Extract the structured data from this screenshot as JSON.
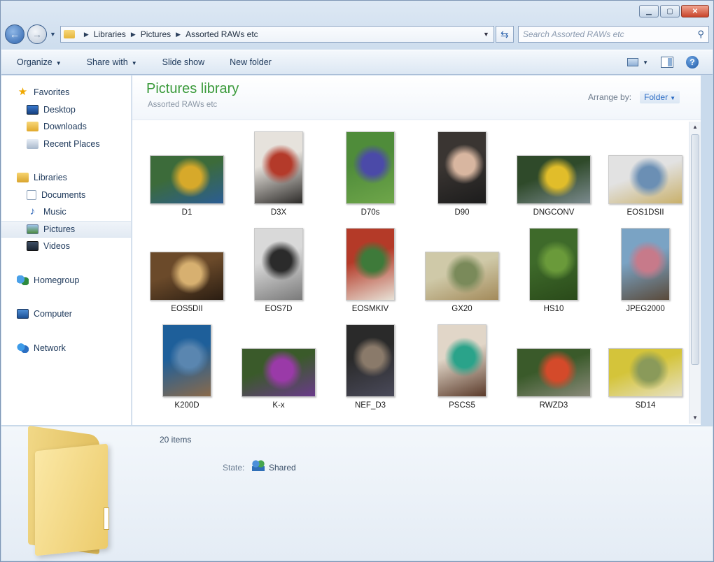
{
  "window": {
    "caption_buttons": [
      "minimize",
      "maximize",
      "close"
    ]
  },
  "address": {
    "crumbs": [
      "Libraries",
      "Pictures",
      "Assorted RAWs etc"
    ],
    "search_placeholder": "Search Assorted RAWs etc"
  },
  "toolbar": {
    "organize": "Organize",
    "share_with": "Share with",
    "slide_show": "Slide show",
    "new_folder": "New folder"
  },
  "nav": {
    "favorites": "Favorites",
    "desktop": "Desktop",
    "downloads": "Downloads",
    "recent_places": "Recent Places",
    "libraries": "Libraries",
    "documents": "Documents",
    "music": "Music",
    "pictures": "Pictures",
    "videos": "Videos",
    "homegroup": "Homegroup",
    "computer": "Computer",
    "network": "Network"
  },
  "library": {
    "title": "Pictures library",
    "subtitle": "Assorted RAWs etc",
    "arrange_label": "Arrange by:",
    "arrange_value": "Folder"
  },
  "items": [
    {
      "label": "D1",
      "orient": "land",
      "colors": [
        "#3c6b3a",
        "#d7a92a",
        "#2b5d94"
      ]
    },
    {
      "label": "D3X",
      "orient": "port",
      "colors": [
        "#e6e2dc",
        "#b43a2a",
        "#2c2a28"
      ]
    },
    {
      "label": "D70s",
      "orient": "port",
      "colors": [
        "#4f8c3a",
        "#4b4aa8",
        "#6fa64a"
      ]
    },
    {
      "label": "D90",
      "orient": "port",
      "colors": [
        "#3a3532",
        "#d8b6a0",
        "#1c1c1c"
      ]
    },
    {
      "label": "DNGCONV",
      "orient": "land",
      "colors": [
        "#2f4a2a",
        "#e1bd2a",
        "#7b8a8e"
      ]
    },
    {
      "label": "EOS1DSII",
      "orient": "land",
      "colors": [
        "#e2e2e2",
        "#6b8fb4",
        "#c9b06a"
      ]
    },
    {
      "label": "EOS5DII",
      "orient": "land",
      "colors": [
        "#6b4a2a",
        "#d7b070",
        "#2a1d12"
      ]
    },
    {
      "label": "EOS7D",
      "orient": "port",
      "colors": [
        "#d9d9d9",
        "#2b2b2b",
        "#7a7a7a"
      ]
    },
    {
      "label": "EOSMKIV",
      "orient": "port",
      "colors": [
        "#b43a28",
        "#3e7a3a",
        "#e7e1d6"
      ]
    },
    {
      "label": "GX20",
      "orient": "land",
      "colors": [
        "#cfc9a8",
        "#7a8a5a",
        "#a38a5a"
      ]
    },
    {
      "label": "HS10",
      "orient": "port",
      "colors": [
        "#3e6a2a",
        "#6a9a3a",
        "#2a4a1a"
      ]
    },
    {
      "label": "JPEG2000",
      "orient": "port",
      "colors": [
        "#7aa3c4",
        "#c77a8a",
        "#5a4a3a"
      ]
    },
    {
      "label": "K200D",
      "orient": "port",
      "colors": [
        "#1e5f9a",
        "#5a86b0",
        "#8a6a4a"
      ]
    },
    {
      "label": "K-x",
      "orient": "land",
      "colors": [
        "#3a5a2a",
        "#9a3aa8",
        "#6a3a8a"
      ]
    },
    {
      "label": "NEF_D3",
      "orient": "port",
      "colors": [
        "#2a2a2a",
        "#8a7a6a",
        "#4a4a5a"
      ]
    },
    {
      "label": "PSCS5",
      "orient": "port",
      "colors": [
        "#e1d6c8",
        "#2aa38a",
        "#5a3a2a"
      ]
    },
    {
      "label": "RWZD3",
      "orient": "land",
      "colors": [
        "#3a5a2a",
        "#d44a2a",
        "#8a8a7a"
      ]
    },
    {
      "label": "SD14",
      "orient": "land",
      "colors": [
        "#d4c43a",
        "#8a9a5a",
        "#e7e1c4"
      ]
    },
    {
      "label": "",
      "orient": "land",
      "colors": [
        "#111111",
        "#222222",
        "#111111"
      ]
    }
  ],
  "details": {
    "item_count": "20 items",
    "state_label": "State:",
    "state_value": "Shared"
  }
}
